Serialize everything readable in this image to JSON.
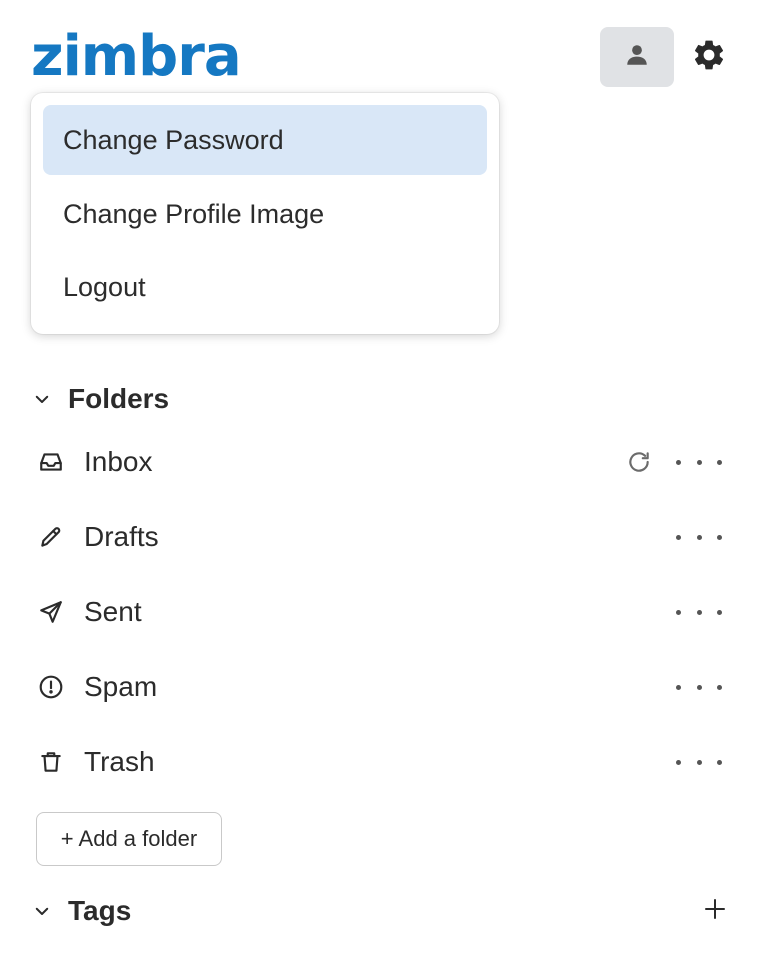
{
  "app": {
    "logo_text": "zimbra",
    "brand_color": "#1578c2"
  },
  "header": {
    "avatar_icon": "person-icon",
    "settings_icon": "gear-icon"
  },
  "user_menu": {
    "items": [
      {
        "label": "Change Password",
        "active": true
      },
      {
        "label": "Change Profile Image",
        "active": false
      },
      {
        "label": "Logout",
        "active": false
      }
    ],
    "active_bg": "#d9e7f7"
  },
  "folders": {
    "title": "Folders",
    "items": [
      {
        "label": "Inbox",
        "icon": "inbox-icon",
        "has_refresh": true
      },
      {
        "label": "Drafts",
        "icon": "pencil-icon"
      },
      {
        "label": "Sent",
        "icon": "send-icon"
      },
      {
        "label": "Spam",
        "icon": "alert-circle-icon"
      },
      {
        "label": "Trash",
        "icon": "trash-icon"
      }
    ],
    "add_label": "+ Add a folder"
  },
  "tags": {
    "title": "Tags",
    "add_icon": "plus-icon"
  }
}
